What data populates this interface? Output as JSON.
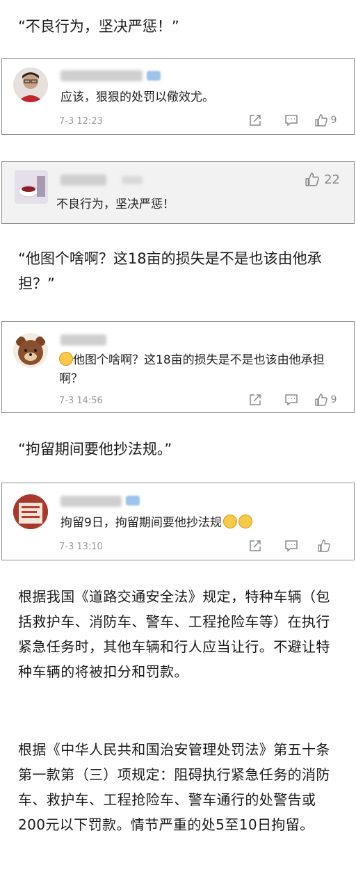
{
  "sections": {
    "quote1": "“不良行为，坚决严惩！”",
    "quote2": "“他图个啥啊？这18亩的损失是不是也该由他承担？”",
    "quote3": "“拘留期间要他抄法规。”"
  },
  "comments": [
    {
      "text": "应该，狠狠的处罚以儆效尤。",
      "time": "7-3 12:23",
      "likes": "9",
      "icons": [
        "share-icon",
        "comment-icon",
        "like-icon"
      ]
    },
    {
      "text": "不良行为，坚决严惩！",
      "likes": "22",
      "icons": [
        "like-icon"
      ]
    },
    {
      "text": "他图个啥啊？这18亩的损失是不是也该由他承担啊？",
      "time": "7-3 14:56",
      "likes": "9",
      "icons": [
        "laugh-emoji",
        "share-icon",
        "comment-icon",
        "like-icon"
      ]
    },
    {
      "text": "拘留9日，拘留期间要他抄法规",
      "time": "7-3 13:10",
      "likes": "",
      "icons": [
        "grin-emoji",
        "grin-emoji",
        "share-icon",
        "comment-icon",
        "like-icon"
      ]
    }
  ],
  "paragraphs": [
    "根据我国《道路交通安全法》规定，特种车辆（包括救护车、消防车、警车、工程抢险车等）在执行紧急任务时，其他车辆和行人应当让行。不避让特种车辆的将被扣分和罚款。",
    "根据《中华人民共和国治安管理处罚法》第五十条第一款第（三）项规定：阻碍执行紧急任务的消防车、救护车、工程抢险车、警车通行的处警告或200元以下罚款。情节严重的处5至10日拘留。"
  ],
  "colors": {
    "text": "#1a1a1a",
    "muted": "#9a9a9a",
    "card_border": "#8c8c8c",
    "card_gray_bg": "#f2f2f2"
  }
}
